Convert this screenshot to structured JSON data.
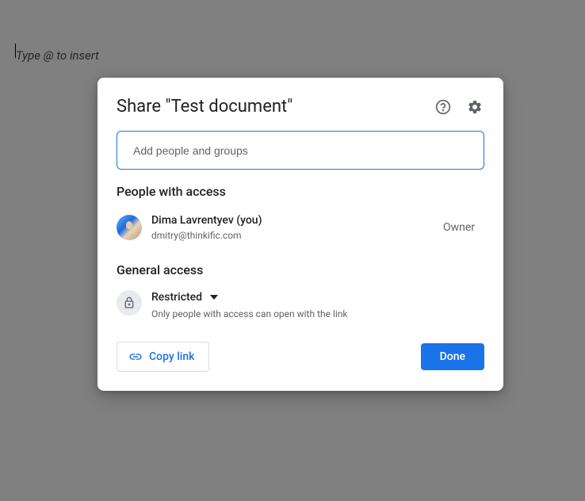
{
  "background": {
    "placeholder": "Type @ to insert"
  },
  "dialog": {
    "title": "Share \"Test document\"",
    "input": {
      "placeholder": "Add people and groups"
    },
    "people_section": {
      "title": "People with access",
      "owner": {
        "name": "Dima Lavrentyev (you)",
        "email": "dmitry@thinkific.com",
        "role": "Owner"
      }
    },
    "general_section": {
      "title": "General access",
      "level": "Restricted",
      "description": "Only people with access can open with the link"
    },
    "actions": {
      "copy_link": "Copy link",
      "done": "Done"
    }
  }
}
